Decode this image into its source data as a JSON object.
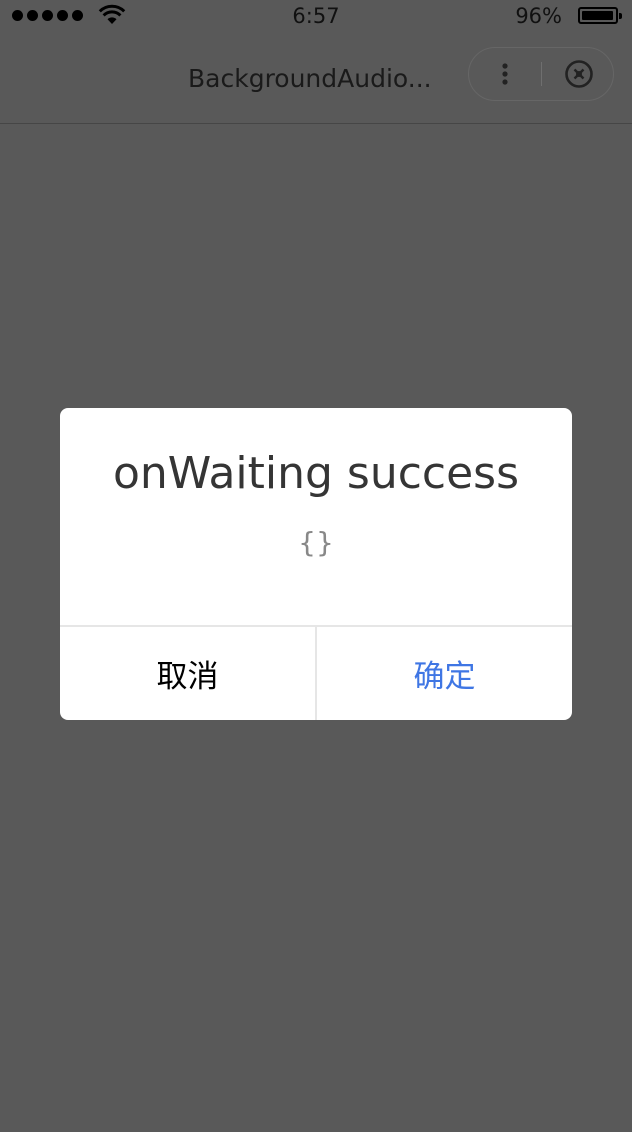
{
  "status_bar": {
    "time": "6:57",
    "battery_percent": "96%",
    "battery_level": 0.96
  },
  "nav_bar": {
    "title": "BackgroundAudio..."
  },
  "modal": {
    "title": "onWaiting success",
    "content": "{}",
    "cancel_label": "取消",
    "confirm_label": "确定",
    "confirm_color": "#3f76e4"
  },
  "colors": {
    "overlay": "#595959",
    "modal_bg": "#ffffff"
  }
}
